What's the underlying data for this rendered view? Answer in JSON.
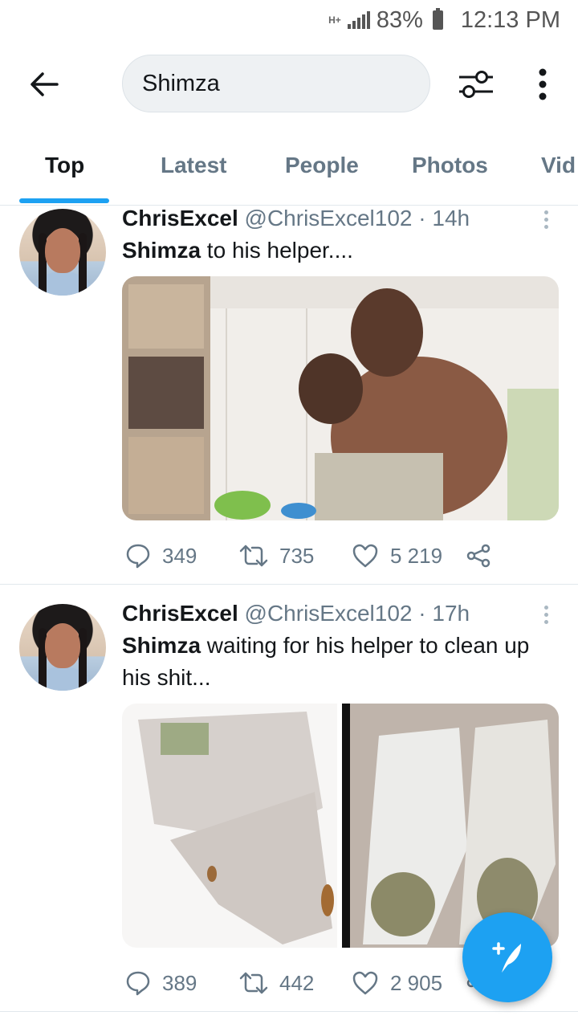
{
  "status_bar": {
    "network": "H+",
    "battery": "83%",
    "time": "12:13 PM"
  },
  "header": {
    "search_value": "Shimza",
    "back_icon": "arrow-left-icon",
    "filter_icon": "sliders-icon",
    "more_icon": "vertical-ellipsis-icon"
  },
  "tabs": [
    {
      "label": "Top",
      "active": true
    },
    {
      "label": "Latest",
      "active": false
    },
    {
      "label": "People",
      "active": false
    },
    {
      "label": "Photos",
      "active": false
    },
    {
      "label": "Vid",
      "active": false
    }
  ],
  "tweets": [
    {
      "name": "ChrisExcel",
      "handle": "@ChrisExcel102",
      "time": "14h",
      "text_bold": "Shimza",
      "text_rest": " to his helper....",
      "replies": "349",
      "retweets": "735",
      "likes": "5 219"
    },
    {
      "name": "ChrisExcel",
      "handle": "@ChrisExcel102",
      "time": "17h",
      "text_bold": "Shimza",
      "text_rest": " waiting for his helper to clean up his shit...",
      "replies": "389",
      "retweets": "442",
      "likes": "2 905"
    }
  ],
  "fab": {
    "icon": "compose-tweet-icon"
  },
  "colors": {
    "accent": "#1da1f2",
    "secondary_text": "#657786",
    "primary_text": "#14171a"
  }
}
